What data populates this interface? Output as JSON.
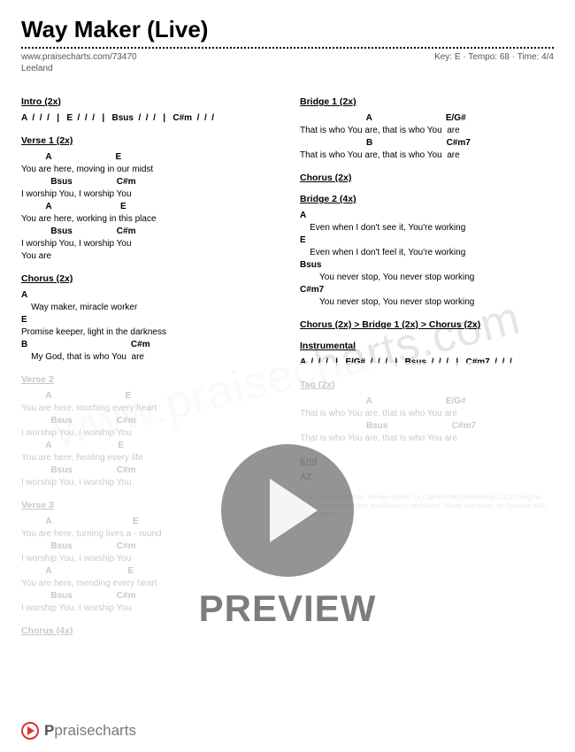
{
  "title": "Way Maker (Live)",
  "url": "www.praisecharts.com/73470",
  "artist": "Leeland",
  "meta": "Key: E · Tempo: 68 · Time: 4/4",
  "watermark": "www.praisecharts.com",
  "preview": "PREVIEW",
  "footer_brand_bold": "P",
  "footer_brand_rest": "praisecharts",
  "left": {
    "intro_title": "Intro (2x)",
    "intro_chords": "A  /  /  /   |   E  /  /  /   |   Bsus  /  /  /   |   C#m  /  /  /",
    "v1_title": "Verse 1 (2x)",
    "v1_c1": "          A                          E",
    "v1_l1": "You are here, moving in our midst",
    "v1_c2": "            Bsus                  C#m",
    "v1_l2": "I worship You, I worship You",
    "v1_c3": "          A                            E",
    "v1_l3": "You are here, working in this place",
    "v1_c4": "            Bsus                  C#m",
    "v1_l4": "I worship You, I worship You",
    "v1_l5": "You are",
    "ch_title": "Chorus (2x)",
    "ch_c1": "A",
    "ch_l1": "    Way maker, miracle worker",
    "ch_c2": "E",
    "ch_l2": "Promise keeper, light in the darkness",
    "ch_c3": "B                                          C#m",
    "ch_l3": "    My God, that is who You  are",
    "v2_title": "Verse 2",
    "v2_c1": "          A                              E",
    "v2_l1": "You are here, touching every heart",
    "v2_c2": "            Bsus                  C#m",
    "v2_l2": "I worship You, I worship You",
    "v2_c3": "          A                           E",
    "v2_l3": "You are here, healing every life",
    "v2_c4": "            Bsus                  C#m",
    "v2_l4": "I worship You, I worship You",
    "v3_title": "Verse 3",
    "v3_c1": "          A                                 E",
    "v3_l1": "You are here, turning lives a - round",
    "v3_c2": "            Bsus                  C#m",
    "v3_l2": "I worship You, I worship You",
    "v3_c3": "          A                               E",
    "v3_l3": "You are here, mending every heart",
    "v3_c4": "            Bsus                  C#m",
    "v3_l4": "I worship You, I worship You",
    "ch4x": "Chorus (4x)"
  },
  "right": {
    "b1_title": "Bridge 1 (2x)",
    "b1_c1": "                           A                              E/G#",
    "b1_l1": "That is who You are, that is who You  are",
    "b1_c2": "                           B                              C#m7",
    "b1_l2": "That is who You are, that is who You  are",
    "ch2x": "Chorus (2x)",
    "b2_title": "Bridge 2 (4x)",
    "b2_c1": "A",
    "b2_l1": "    Even when I don't see it, You're working",
    "b2_c2": "E",
    "b2_l2": "    Even when I don't feel it, You're working",
    "b2_c3": "Bsus",
    "b2_l3": "        You never stop, You never stop working",
    "b2_c4": "C#m7",
    "b2_l4": "        You never stop, You never stop working",
    "flow": "Chorus (2x)  >  Bridge 1 (2x)  >  Chorus (2x)",
    "inst_title": "Instrumental",
    "inst_chords": "A  /  /  /   |   E/G#  /  /  /   |   Bsus  /  /  /   |   C#m7  /  /  /",
    "tag_title": "Tag (2x)",
    "tag_c1": "                           A                              E/G#",
    "tag_l1": "That is who You are, that is who You are",
    "tag_c2": "                           Bsus                          C#m7",
    "tag_l2": "That is who You are, that is who You are",
    "end_title": "End",
    "end_c": "A2",
    "copyright": "© 2016 Integrity Music Europe (Admin by Capitol CMG Publishing). CCLI Song No. 7115744. Unauthorized distribution is prohibited. Words and music by Osinachi Kalu Okoro Egbu."
  }
}
